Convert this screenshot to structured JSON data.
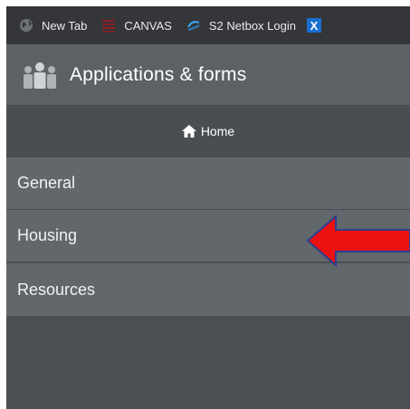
{
  "bookmarks": [
    {
      "label": "New Tab",
      "icon": "globe-icon"
    },
    {
      "label": "CANVAS",
      "icon": "canvas-icon"
    },
    {
      "label": "S2 Netbox Login",
      "icon": "netbox-icon"
    },
    {
      "label": "X",
      "icon": "x-app-icon"
    }
  ],
  "header": {
    "title": "Applications & forms",
    "icon": "people-icon"
  },
  "home": {
    "label": "Home",
    "icon": "home-icon"
  },
  "menu": {
    "items": [
      {
        "label": "General"
      },
      {
        "label": "Housing"
      },
      {
        "label": "Resources"
      }
    ]
  },
  "annotation": {
    "icon": "red-arrow-icon",
    "color": "#ee1111",
    "points_to": "Housing"
  },
  "colors": {
    "bookmarks_bg": "#35363a",
    "header_bg": "#5d6166",
    "home_bg": "#4a4e52",
    "menu_bg": "#62676c"
  }
}
